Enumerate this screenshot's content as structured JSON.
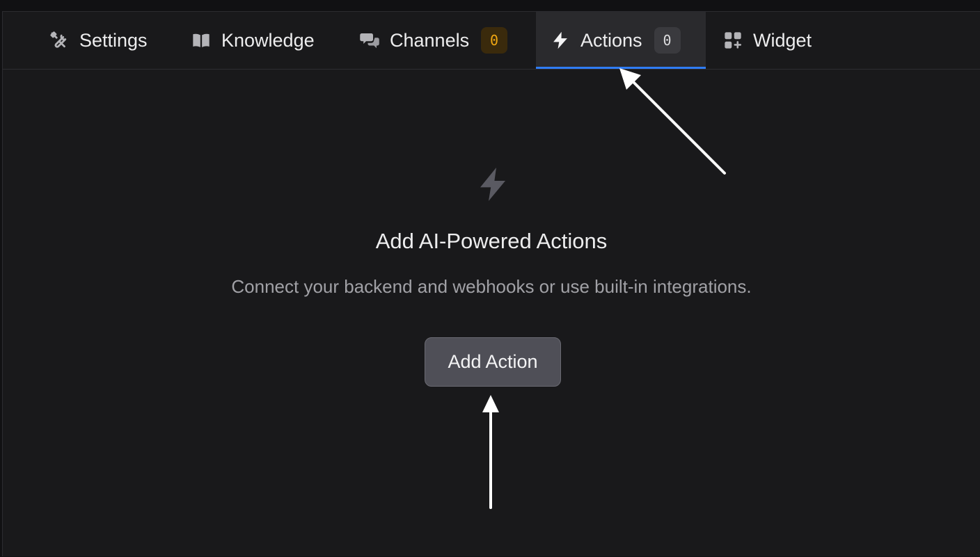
{
  "tabs": [
    {
      "label": "Settings",
      "icon": "wrench-screwdriver-icon"
    },
    {
      "label": "Knowledge",
      "icon": "book-icon"
    },
    {
      "label": "Channels",
      "icon": "chat-bubbles-icon",
      "badge": "0"
    },
    {
      "label": "Actions",
      "icon": "lightning-icon",
      "badge": "0",
      "active": true
    },
    {
      "label": "Widget",
      "icon": "grid-plus-icon"
    }
  ],
  "empty_state": {
    "icon": "lightning-icon",
    "title": "Add AI-Powered Actions",
    "subtitle": "Connect your backend and webhooks or use built-in integrations.",
    "button_label": "Add Action"
  },
  "colors": {
    "background": "#19191b",
    "active_tab_underline": "#2f7cf6",
    "channels_badge": "#f0a712",
    "button_bg": "#4f4f57"
  }
}
